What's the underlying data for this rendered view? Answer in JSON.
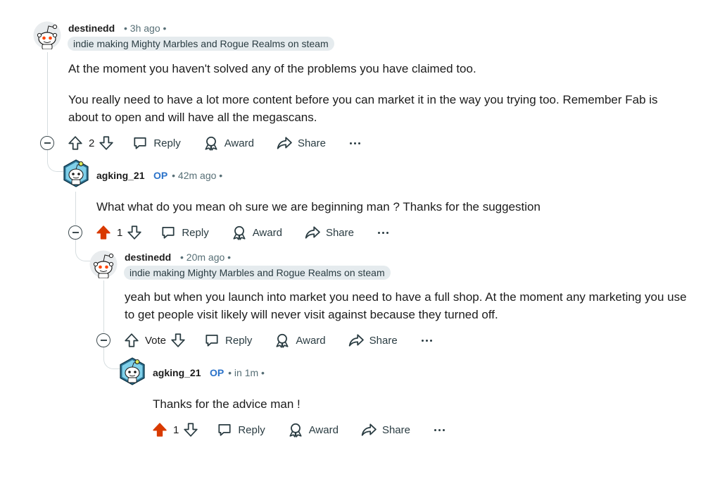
{
  "comments": [
    {
      "username": "destinedd",
      "meta": "• 3h ago •",
      "flair": "indie making Mighty Marbles and Rogue Realms on steam",
      "paragraphs": [
        "At the moment you haven't solved any of the problems you have claimed too.",
        "You really need to have a lot more content before you can market it in the way you trying too. Remember Fab is about to open and will have all the megascans."
      ],
      "score": "2",
      "upvoted": false
    },
    {
      "username": "agking_21",
      "op": "OP",
      "meta": "• 42m ago •",
      "paragraphs": [
        "What what do you mean oh sure we are beginning man ? Thanks for the suggestion"
      ],
      "score": "1",
      "upvoted": true
    },
    {
      "username": "destinedd",
      "meta": "• 20m ago •",
      "flair": "indie making Mighty Marbles and Rogue Realms on steam",
      "paragraphs": [
        "yeah but when you launch into market you need to have a full shop. At the moment any marketing you use to get people visit likely will never visit against because they turned off."
      ],
      "score": "Vote",
      "upvoted": false
    },
    {
      "username": "agking_21",
      "op": "OP",
      "meta": "• in 1m •",
      "paragraphs": [
        "Thanks for the advice man !"
      ],
      "score": "1",
      "upvoted": true
    }
  ],
  "actions": {
    "reply": "Reply",
    "award": "Award",
    "share": "Share"
  },
  "colors": {
    "upvote_active": "#d93a00",
    "op": "#2a72c9",
    "thread_line": "#d6dde0",
    "flair_bg": "#e5ebee"
  },
  "icons": {
    "upvote": "upvote-arrow-icon",
    "downvote": "downvote-arrow-icon",
    "reply": "speech-bubble-icon",
    "award": "award-ribbon-icon",
    "share": "share-arrow-icon",
    "more": "ellipsis-icon",
    "collapse": "collapse-minus-icon"
  }
}
